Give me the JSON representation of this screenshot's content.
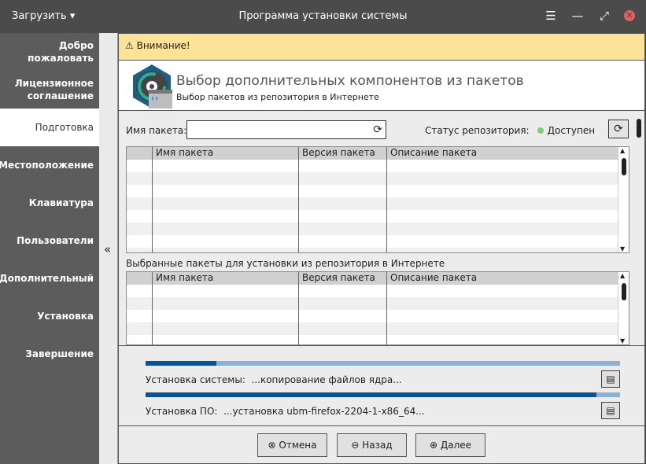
{
  "titlebar": {
    "menu": "Загрузить",
    "title": "Программа установки системы"
  },
  "sidebar": {
    "items": [
      {
        "label": "Добро пожаловать"
      },
      {
        "label": "Лицензионное соглашение"
      },
      {
        "label": "Подготовка",
        "active": true
      },
      {
        "label": "Местоположение"
      },
      {
        "label": "Клавиатура"
      },
      {
        "label": "Пользователи"
      },
      {
        "label": "Дополнительный"
      },
      {
        "label": "Установка"
      },
      {
        "label": "Завершение"
      }
    ]
  },
  "collapse_label": "«",
  "warning": "Внимание!",
  "header": {
    "title": "Выбор дополнительных компонентов из пакетов",
    "subtitle": "Выбор пакетов из репозитория в Интернете"
  },
  "search": {
    "label": "Имя пакета:",
    "value": ""
  },
  "repo": {
    "label": "Статус репозитория:",
    "status": "Доступен",
    "status_color": "#7fc97f"
  },
  "table_columns": [
    "",
    "Имя пакета",
    "Версия пакета",
    "Описание пакета"
  ],
  "selected_label": "Выбранные пакеты для установки из репозитория в Интернете",
  "progress": {
    "system_label": "Установка системы:",
    "system_text": "...копирование файлов ядра...",
    "system_value": 0.15,
    "software_label": "Установка ПО:",
    "software_text": "...установка ubm-firefox-2204-1-x86_64...",
    "software_value": 0.95
  },
  "buttons": {
    "cancel": "Отмена",
    "back": "Назад",
    "next": "Далее"
  },
  "colors": {
    "accent": "#0b5394",
    "warning_bg": "#fce398"
  }
}
